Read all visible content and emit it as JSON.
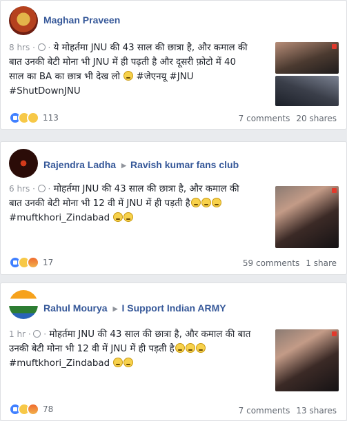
{
  "posts": [
    {
      "author": "Maghan Praveen",
      "group": "",
      "time": "8 hrs",
      "text_lines": [
        "ये मोहर्तमा JNU की 43 साल की छात्रा है, और कमाल की",
        "बात उनकी बेटी मोना भी JNU में ही पढ़ती है और दूसरी फ़ोटो में 40",
        "साल का BA का छात्र भी देख लो"
      ],
      "hashtags_inline": "#जेएनयू #JNU",
      "hashtags": "#ShutDownJNU",
      "reactions": [
        "like",
        "haha",
        "sad"
      ],
      "reaction_count": "113",
      "comments": "7 comments",
      "shares": "20 shares"
    },
    {
      "author": "Rajendra Ladha",
      "group": "Ravish kumar fans club",
      "time": "6 hrs",
      "text_lines": [
        "मोहर्तमा JNU की 43 साल की छात्रा है, और कमाल की",
        "बात उनकी बेटी मोना भी 12 वी में JNU में ही पड़ती है"
      ],
      "hashtags": "#muftkhori_Zindabad",
      "reactions": [
        "like",
        "sad",
        "angry"
      ],
      "reaction_count": "17",
      "comments": "59 comments",
      "shares": "1 share"
    },
    {
      "author": "Rahul Mourya",
      "group": "I Support Indian ARMY",
      "time": "1 hr",
      "text_lines": [
        "मोहर्तमा JNU की 43 साल की छात्रा है, और कमाल की बात",
        "उनकी बेटी मोना भी 12 वी में JNU में ही पड़ती है"
      ],
      "hashtags": "#muftkhori_Zindabad",
      "reactions": [
        "like",
        "haha",
        "angry"
      ],
      "reaction_count": "78",
      "comments": "7 comments",
      "shares": "13 shares"
    }
  ]
}
